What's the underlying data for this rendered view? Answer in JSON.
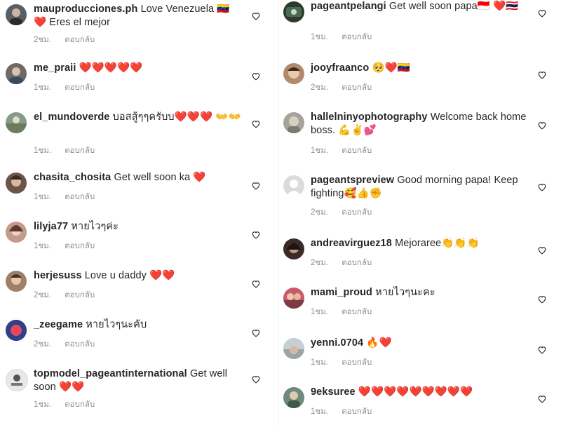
{
  "left_comments": [
    {
      "user": "mauproducciones.ph",
      "text": "Love Venezuela 🇻🇪 ❤️ Eres el mejor",
      "time": "2ชม.",
      "reply": "ตอบกลับ",
      "avatar_color": "#5a5d63"
    },
    {
      "user": "me_praii",
      "text": "❤️❤️❤️❤️❤️",
      "time": "1ชม.",
      "reply": "ตอบกลับ",
      "avatar_color": "#6e6a66"
    },
    {
      "user": "el_mundoverde",
      "text": "บอสสู้ๆๆครับบ❤️❤️❤️ 👐👐",
      "time": "1ชม.",
      "reply": "ตอบกลับ",
      "avatar_color": "#8a9a8a"
    },
    {
      "user": "chasita_chosita",
      "text": "Get well soon ka ❤️",
      "time": "1ชม.",
      "reply": "ตอบกลับ",
      "avatar_color": "#6b5448"
    },
    {
      "user": "lilyja77",
      "text": "หายไวๆค่ะ",
      "time": "1ชม.",
      "reply": "ตอบกลับ",
      "avatar_color": "#c49a8a"
    },
    {
      "user": "herjesuss",
      "text": "Love u daddy ❤️❤️",
      "time": "2ชม.",
      "reply": "ตอบกลับ",
      "avatar_color": "#9e7f6a"
    },
    {
      "user": "_zeegame",
      "text": "หายไวๆนะคับ",
      "time": "2ชม.",
      "reply": "ตอบกลับ",
      "avatar_color": "#b8475a"
    },
    {
      "user": "topmodel_pageantinternational",
      "text": "Get well soon ❤️❤️",
      "time": "1ชม.",
      "reply": "ตอบกลับ",
      "avatar_color": "#e8e8e8"
    }
  ],
  "right_comments": [
    {
      "user": "pageantpelangi",
      "text": "Get well soon papa🇮🇩 ❤️🇹🇭",
      "time": "1ชม.",
      "reply": "ตอบกลับ",
      "avatar_color": "#2d3a2e"
    },
    {
      "user": "jooyfraanco",
      "text": "🥺❤️🇻🇪",
      "time": "2ชม.",
      "reply": "ตอบกลับ",
      "avatar_color": "#b08a6c"
    },
    {
      "user": "hallelniny​ophotography",
      "text": "Welcome back home boss. 💪✌️💕",
      "time": "1ชม.",
      "reply": "ตอบกลับ",
      "avatar_color": "#a7a39a"
    },
    {
      "user": "pageantspreview",
      "text": "Good morning papa! Keep fighting🥰👍✊",
      "time": "2ชม.",
      "reply": "ตอบกลับ",
      "avatar_color": "#dbdbdb"
    },
    {
      "user": "andreavirguez18",
      "text": "Mejoraree👏👏👏",
      "time": "2ชม.",
      "reply": "ตอบกลับ",
      "avatar_color": "#3b2b28"
    },
    {
      "user": "mami_proud",
      "text": "หายไวๆนะคะ",
      "time": "1ชม.",
      "reply": "ตอบกลับ",
      "avatar_color": "#c85a6a"
    },
    {
      "user": "yenni.0704",
      "text": "🔥❤️",
      "time": "1ชม.",
      "reply": "ตอบกลับ",
      "avatar_color": "#9aa5a8"
    },
    {
      "user": "9eksuree",
      "text": "❤️❤️❤️❤️❤️❤️❤️❤️❤️",
      "time": "1ชม.",
      "reply": "ตอบกลับ",
      "avatar_color": "#6d8a7a"
    }
  ],
  "icons": {
    "like": "heart-outline-icon"
  }
}
